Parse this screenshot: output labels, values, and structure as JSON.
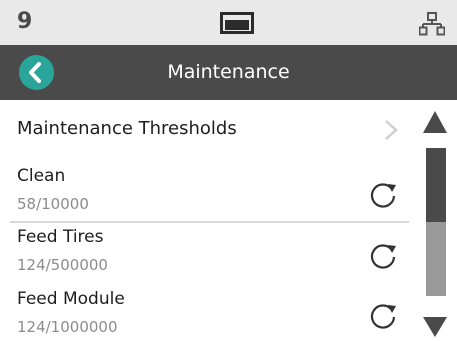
{
  "status_bar": {
    "number": "9",
    "screen_icon": "screen-icon",
    "network_icon": "network-icon"
  },
  "header": {
    "title": "Maintenance",
    "back_icon": "chevron-left-icon",
    "accent_color": "#2aa59a"
  },
  "menu": {
    "thresholds_label": "Maintenance Thresholds",
    "chevron_icon": "chevron-right-icon"
  },
  "items": [
    {
      "title": "Clean",
      "count": "58/10000",
      "reset_icon": "refresh-icon"
    },
    {
      "title": "Feed Tires",
      "count": "124/500000",
      "reset_icon": "refresh-icon"
    },
    {
      "title": "Feed Module",
      "count": "124/1000000",
      "reset_icon": "refresh-icon"
    }
  ],
  "scrollbar": {
    "up_icon": "triangle-up-icon",
    "down_icon": "triangle-down-icon",
    "thumb_fraction": 0.5,
    "position_fraction": 0
  },
  "colors": {
    "header_bg": "#4a4a4a",
    "status_bg": "#e9e9e9"
  }
}
